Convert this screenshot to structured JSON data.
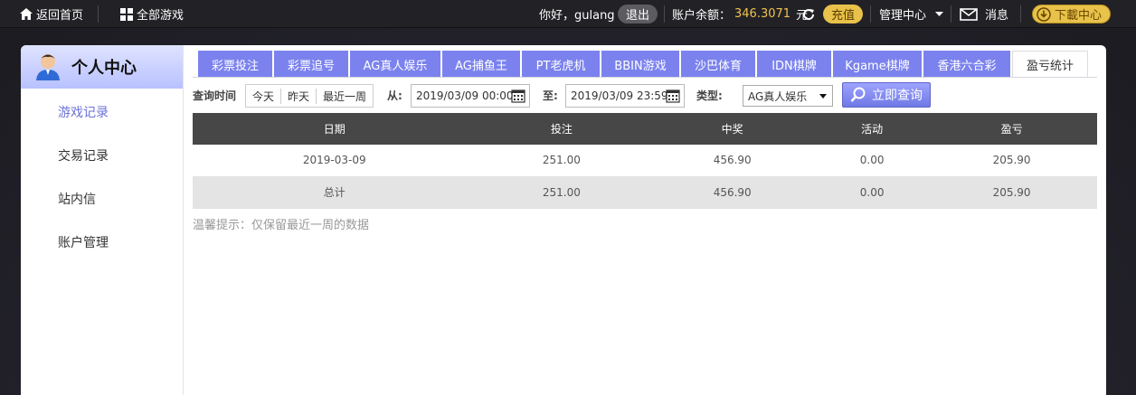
{
  "topbar": {
    "home_label": "返回首页",
    "all_games_label": "全部游戏",
    "greeting": "你好，gulang",
    "logout_label": "退出",
    "balance_label": "账户余额：",
    "balance_value": "346.3071",
    "currency": "元",
    "recharge_label": "充值",
    "manage_label": "管理中心",
    "message_label": "消息",
    "download_label": "下載中心"
  },
  "sidebar": {
    "title": "个人中心",
    "items": [
      {
        "label": "游戏记录",
        "active": true
      },
      {
        "label": "交易记录",
        "active": false
      },
      {
        "label": "站内信",
        "active": false
      },
      {
        "label": "账户管理",
        "active": false
      }
    ]
  },
  "tabs": [
    {
      "label": "彩票投注"
    },
    {
      "label": "彩票追号"
    },
    {
      "label": "AG真人娱乐"
    },
    {
      "label": "AG捕鱼王"
    },
    {
      "label": "PT老虎机"
    },
    {
      "label": "BBIN游戏"
    },
    {
      "label": "沙巴体育"
    },
    {
      "label": "IDN棋牌"
    },
    {
      "label": "Kgame棋牌"
    },
    {
      "label": "香港六合彩"
    },
    {
      "label": "盈亏统计",
      "active": true
    }
  ],
  "filter": {
    "query_time_label": "查询时间",
    "today": "今天",
    "yesterday": "昨天",
    "last_week": "最近一周",
    "from_label": "从:",
    "from_value": "2019/03/09 00:00",
    "to_label": "至:",
    "to_value": "2019/03/09 23:59",
    "type_label": "类型:",
    "type_value": "AG真人娱乐",
    "query_button": "立即查询"
  },
  "table": {
    "columns": [
      "日期",
      "投注",
      "中奖",
      "活动",
      "盈亏"
    ],
    "rows": [
      [
        "2019-03-09",
        "251.00",
        "456.90",
        "0.00",
        "205.90"
      ],
      [
        "总计",
        "251.00",
        "456.90",
        "0.00",
        "205.90"
      ]
    ]
  },
  "tip": "温馨提示：仅保留最近一周的数据",
  "colors": {
    "topbar_bg": "#222226",
    "accent_tab": "#7b82ee",
    "gold": "#e8c24a",
    "table_header": "#474747"
  }
}
